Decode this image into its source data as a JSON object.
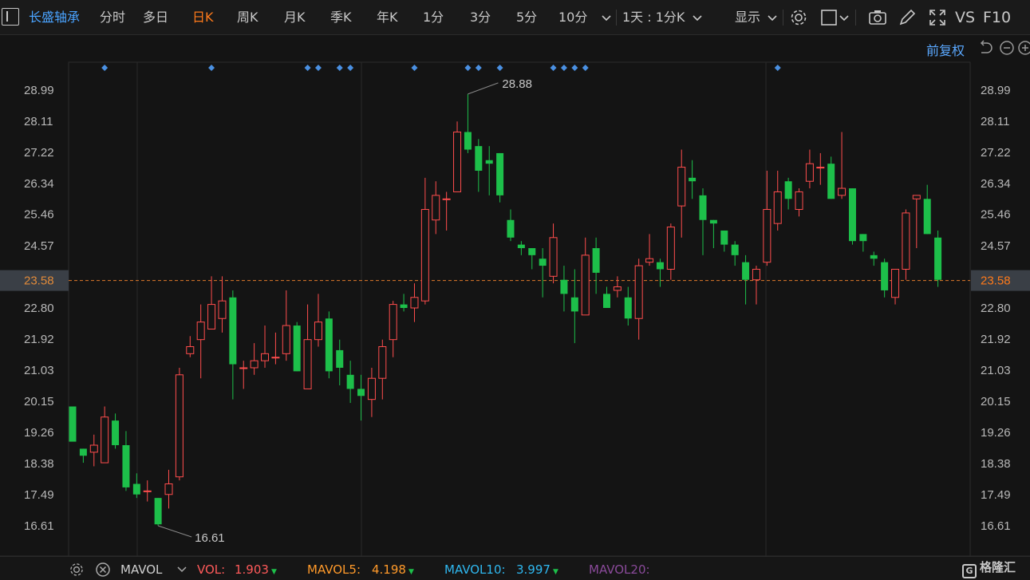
{
  "toolbar": {
    "stock_name": "长盛轴承",
    "tabs": [
      "分时",
      "多日",
      "日K",
      "周K",
      "月K",
      "季K",
      "年K",
      "1分",
      "3分",
      "5分",
      "10分"
    ],
    "active_tab": "日K",
    "period_select": "1天 : 1分K",
    "display_label": "显示",
    "vs_label": "VS",
    "f10_label": "F10"
  },
  "adjust_label": "前复权",
  "chart_data": {
    "type": "candlestick",
    "ylim": [
      16.2,
      29.4
    ],
    "y_ticks": [
      "28.99",
      "28.11",
      "27.22",
      "26.34",
      "25.46",
      "24.57",
      "23.58",
      "22.80",
      "21.92",
      "21.03",
      "20.15",
      "19.26",
      "18.38",
      "17.49",
      "16.61"
    ],
    "current_price": "23.58",
    "max_label": "28.88",
    "min_label": "16.61",
    "colors": {
      "up": "#ff4d4d",
      "down": "#1dbf4a",
      "dashed": "#e07a2a",
      "event": "#4a90e2"
    },
    "candles": [
      [
        20.0,
        19.2,
        19.0,
        18.8,
        18.8
      ],
      [
        18.8,
        19.0,
        18.6,
        18.8,
        18.4
      ],
      [
        18.7,
        18.9,
        18.9,
        19.2,
        18.3
      ],
      [
        18.4,
        19.9,
        19.7,
        20.0,
        18.4
      ],
      [
        19.6,
        19.6,
        18.9,
        19.8,
        18.8
      ],
      [
        18.9,
        19.2,
        17.7,
        19.3,
        17.6
      ],
      [
        17.8,
        17.9,
        17.5,
        18.1,
        17.4
      ],
      [
        17.6,
        17.7,
        17.6,
        17.9,
        17.3
      ],
      [
        17.4,
        17.4,
        16.65,
        17.4,
        16.61
      ],
      [
        17.5,
        17.9,
        17.8,
        18.2,
        17.1
      ],
      [
        18.0,
        21.0,
        20.9,
        21.1,
        17.9
      ],
      [
        21.5,
        22.0,
        21.7,
        22.0,
        21.4
      ],
      [
        21.9,
        22.6,
        22.4,
        22.9,
        20.8
      ],
      [
        22.2,
        22.8,
        22.9,
        23.7,
        22.2
      ],
      [
        22.5,
        22.9,
        23.0,
        23.7,
        22.1
      ],
      [
        23.1,
        23.0,
        21.2,
        23.3,
        20.2
      ],
      [
        21.1,
        21.2,
        21.1,
        21.3,
        20.5
      ],
      [
        21.1,
        21.5,
        21.3,
        21.8,
        20.9
      ],
      [
        21.3,
        21.5,
        21.5,
        22.3,
        21.1
      ],
      [
        21.4,
        21.6,
        21.4,
        22.1,
        21.2
      ],
      [
        21.5,
        21.6,
        22.3,
        23.3,
        21.3
      ],
      [
        22.3,
        22.3,
        21.0,
        22.4,
        21.0
      ],
      [
        20.5,
        20.6,
        21.9,
        22.9,
        20.5
      ],
      [
        21.9,
        22.3,
        22.4,
        23.2,
        21.7
      ],
      [
        22.5,
        22.6,
        21.0,
        22.7,
        20.8
      ],
      [
        21.6,
        21.7,
        21.1,
        21.9,
        20.6
      ],
      [
        20.9,
        20.9,
        20.5,
        21.3,
        20.1
      ],
      [
        20.5,
        20.7,
        20.3,
        20.9,
        19.6
      ],
      [
        20.2,
        20.2,
        20.8,
        21.1,
        19.7
      ],
      [
        20.8,
        20.8,
        21.7,
        21.9,
        20.2
      ],
      [
        21.9,
        22.0,
        22.9,
        23.0,
        21.4
      ],
      [
        22.9,
        22.9,
        22.8,
        23.2,
        22.7
      ],
      [
        22.8,
        23.1,
        23.1,
        23.5,
        22.4
      ],
      [
        23.0,
        23.0,
        25.6,
        26.5,
        22.9
      ],
      [
        25.3,
        25.6,
        26.0,
        26.4,
        24.9
      ],
      [
        25.9,
        25.9,
        25.9,
        26.1,
        25.0
      ],
      [
        26.1,
        26.2,
        27.8,
        28.1,
        26.1
      ],
      [
        27.8,
        27.8,
        27.3,
        28.88,
        27.2
      ],
      [
        27.4,
        27.5,
        26.7,
        27.6,
        26.1
      ],
      [
        27.0,
        27.0,
        26.9,
        27.4,
        26.0
      ],
      [
        27.2,
        27.1,
        26.0,
        27.2,
        25.8
      ],
      [
        25.3,
        25.3,
        24.8,
        25.6,
        24.7
      ],
      [
        24.6,
        24.6,
        24.5,
        24.7,
        24.3
      ],
      [
        24.5,
        24.5,
        24.3,
        24.5,
        23.9
      ],
      [
        24.2,
        24.2,
        24.0,
        24.5,
        23.1
      ],
      [
        23.7,
        23.7,
        24.8,
        25.2,
        23.5
      ],
      [
        23.6,
        23.6,
        23.2,
        24.0,
        22.7
      ],
      [
        23.1,
        23.1,
        22.7,
        23.9,
        21.8
      ],
      [
        22.6,
        22.6,
        24.3,
        24.8,
        22.7
      ],
      [
        24.5,
        24.4,
        23.8,
        24.8,
        23.2
      ],
      [
        23.2,
        23.2,
        22.8,
        23.4,
        22.8
      ],
      [
        23.3,
        23.3,
        23.4,
        23.7,
        23.1
      ],
      [
        23.1,
        23.1,
        22.5,
        23.4,
        22.3
      ],
      [
        22.5,
        22.5,
        24.0,
        24.2,
        21.9
      ],
      [
        24.1,
        24.1,
        24.2,
        24.9,
        24.0
      ],
      [
        24.1,
        24.2,
        23.9,
        24.2,
        23.4
      ],
      [
        23.9,
        23.9,
        25.1,
        25.2,
        23.6
      ],
      [
        25.7,
        25.7,
        26.8,
        27.3,
        24.8
      ],
      [
        26.5,
        26.4,
        26.4,
        27.0,
        25.9
      ],
      [
        26.0,
        26.0,
        25.3,
        26.2,
        24.3
      ],
      [
        25.3,
        25.3,
        25.2,
        25.3,
        24.5
      ],
      [
        25.0,
        25.0,
        24.6,
        25.0,
        24.4
      ],
      [
        24.6,
        24.6,
        24.3,
        24.7,
        24.0
      ],
      [
        24.1,
        24.1,
        23.6,
        24.3,
        22.9
      ],
      [
        23.6,
        23.6,
        23.9,
        24.0,
        22.9
      ],
      [
        24.1,
        24.2,
        25.6,
        26.7,
        24.0
      ],
      [
        25.2,
        25.3,
        26.1,
        26.7,
        25.0
      ],
      [
        26.4,
        26.4,
        25.9,
        26.5,
        25.6
      ],
      [
        25.6,
        25.6,
        26.1,
        26.2,
        25.4
      ],
      [
        26.4,
        26.4,
        26.9,
        27.3,
        26.2
      ],
      [
        26.8,
        26.8,
        26.8,
        27.2,
        26.3
      ],
      [
        26.9,
        26.8,
        25.9,
        27.1,
        25.9
      ],
      [
        26.0,
        26.0,
        26.2,
        27.8,
        25.9
      ],
      [
        26.2,
        26.2,
        24.7,
        26.2,
        24.6
      ],
      [
        24.9,
        24.9,
        24.7,
        24.9,
        24.4
      ],
      [
        24.3,
        24.3,
        24.2,
        24.4,
        24.0
      ],
      [
        24.1,
        24.1,
        23.3,
        24.2,
        23.1
      ],
      [
        23.1,
        23.1,
        23.9,
        23.9,
        22.9
      ],
      [
        23.9,
        23.9,
        25.5,
        25.6,
        23.6
      ],
      [
        25.9,
        25.9,
        26.0,
        26.0,
        24.5
      ],
      [
        25.9,
        25.9,
        24.9,
        26.3,
        24.9
      ],
      [
        24.8,
        24.8,
        23.6,
        25.0,
        23.4
      ]
    ],
    "event_markers": [
      3,
      13,
      22,
      23,
      25,
      26,
      32,
      37,
      38,
      40,
      45,
      46,
      47,
      48,
      66
    ]
  },
  "bottom": {
    "indicator": "MAVOL",
    "vol_label": "VOL:",
    "vol_value": "1.903",
    "mavol5_label": "MAVOL5:",
    "mavol5_value": "4.198",
    "mavol10_label": "MAVOL10:",
    "mavol10_value": "3.997",
    "mavol20_label": "MAVOL20:"
  },
  "logo_text": "格隆汇"
}
